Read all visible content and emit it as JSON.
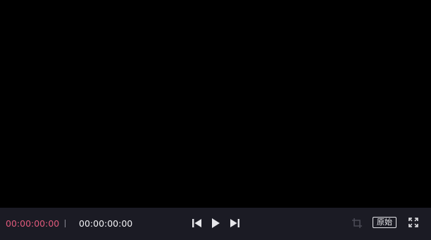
{
  "time": {
    "current": "00:00:00:00",
    "total": "00:00:00:00"
  },
  "buttons": {
    "original_label": "原始"
  },
  "icons": {
    "prev": "skip-previous-icon",
    "play": "play-icon",
    "next": "skip-next-icon",
    "crop": "crop-icon",
    "fullscreen": "fullscreen-icon"
  },
  "colors": {
    "current_time": "#e05a7c",
    "total_time": "#f2f2f5",
    "control_bar": "#1b1b24",
    "icon": "#e6e6ea",
    "icon_disabled": "#4a4a55"
  }
}
